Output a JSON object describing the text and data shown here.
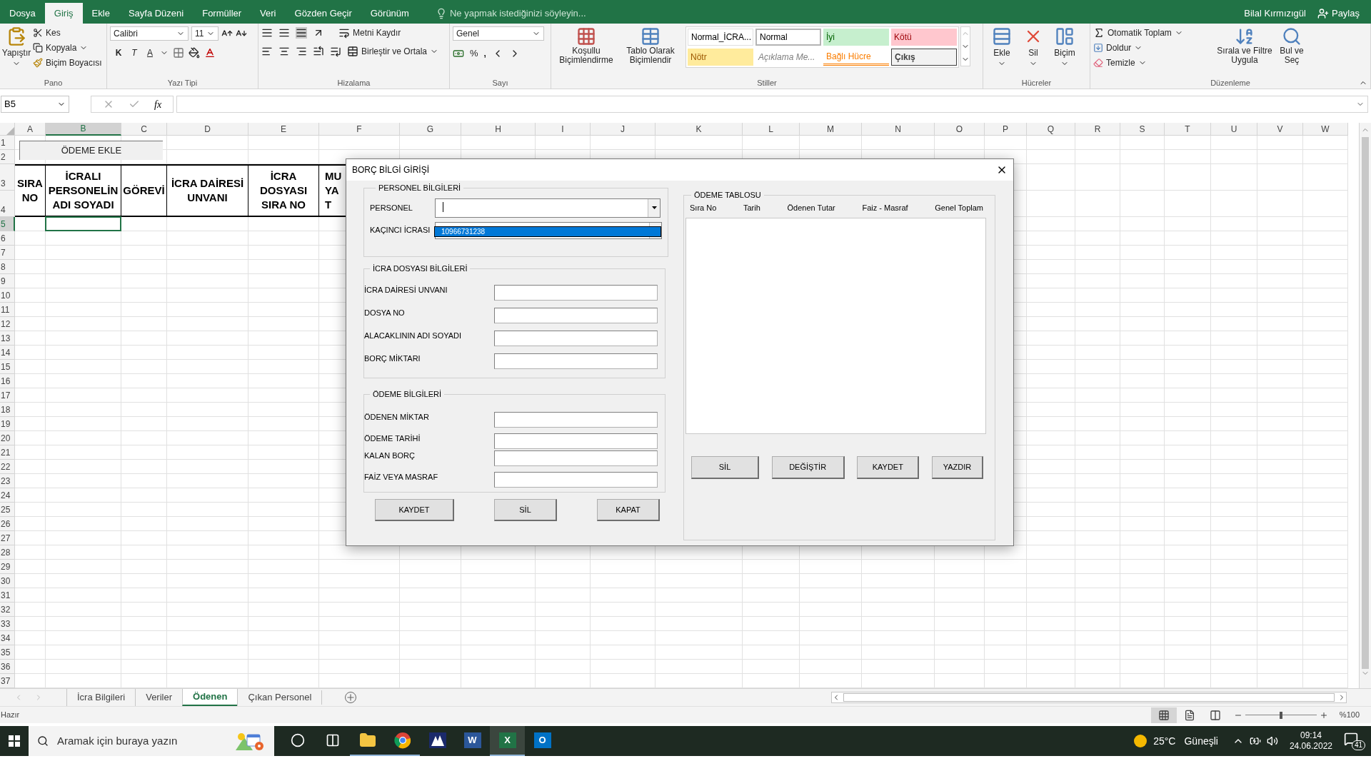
{
  "title_bar": {
    "tabs": [
      {
        "label": "Dosya",
        "selected": false
      },
      {
        "label": "Giriş",
        "selected": true
      },
      {
        "label": "Ekle",
        "selected": false
      },
      {
        "label": "Sayfa Düzeni",
        "selected": false
      },
      {
        "label": "Formüller",
        "selected": false
      },
      {
        "label": "Veri",
        "selected": false
      },
      {
        "label": "Gözden Geçir",
        "selected": false
      },
      {
        "label": "Görünüm",
        "selected": false
      }
    ],
    "tell_me": "Ne yapmak istediğinizi söyleyin...",
    "user": "Bilal Kırmızıgül",
    "share": "Paylaş"
  },
  "ribbon": {
    "clipboard": {
      "paste": "Yapıştır",
      "cut": "Kes",
      "copy": "Kopyala",
      "format_painter": "Biçim Boyacısı",
      "group": "Pano"
    },
    "font": {
      "name": "Calibri",
      "size": "11",
      "bold": "K",
      "italic": "T",
      "underline": "A",
      "group": "Yazı Tipi"
    },
    "alignment": {
      "wrap": "Metni Kaydır",
      "merge": "Birleştir ve Ortala",
      "group": "Hizalama"
    },
    "number": {
      "format": "Genel",
      "percent": "%",
      "comma": ",",
      "group": "Sayı"
    },
    "styles": {
      "conditional": "Koşullu Biçimlendirme",
      "table": "Tablo Olarak Biçimlendir",
      "group": "Stiller",
      "cells": [
        {
          "label": "Normal_İCRA...",
          "kind": "custom"
        },
        {
          "label": "Normal",
          "kind": "normal"
        },
        {
          "label": "İyi",
          "kind": "good"
        },
        {
          "label": "Kötü",
          "kind": "bad"
        },
        {
          "label": "Nötr",
          "kind": "neutral"
        },
        {
          "label": "Açıklama Me...",
          "kind": "note"
        },
        {
          "label": "Bağlı Hücre",
          "kind": "linked"
        },
        {
          "label": "Çıkış",
          "kind": "output"
        }
      ]
    },
    "cells": {
      "insert": "Ekle",
      "delete": "Sil",
      "format": "Biçim",
      "group": "Hücreler"
    },
    "editing": {
      "autosum": "Otomatik Toplam",
      "fill": "Doldur",
      "clear": "Temizle",
      "sort": "Sırala ve Filtre Uygula",
      "find": "Bul ve Seç",
      "group": "Düzenleme"
    }
  },
  "formula_bar": {
    "name_box": "B5",
    "fx": "fx"
  },
  "sheet": {
    "columns": [
      {
        "label": "A",
        "selected": false
      },
      {
        "label": "B",
        "selected": true
      },
      {
        "label": "C",
        "selected": false
      },
      {
        "label": "D",
        "selected": false
      },
      {
        "label": "E",
        "selected": false
      },
      {
        "label": "F",
        "selected": false
      },
      {
        "label": "G",
        "selected": false
      },
      {
        "label": "H",
        "selected": false
      },
      {
        "label": "I",
        "selected": false
      },
      {
        "label": "J",
        "selected": false
      },
      {
        "label": "K",
        "selected": false
      },
      {
        "label": "L",
        "selected": false
      },
      {
        "label": "M",
        "selected": false
      },
      {
        "label": "N",
        "selected": false
      },
      {
        "label": "O",
        "selected": false
      },
      {
        "label": "P",
        "selected": false
      },
      {
        "label": "Q",
        "selected": false
      },
      {
        "label": "R",
        "selected": false
      },
      {
        "label": "S",
        "selected": false
      },
      {
        "label": "T",
        "selected": false
      },
      {
        "label": "U",
        "selected": false
      },
      {
        "label": "V",
        "selected": false
      },
      {
        "label": "W",
        "selected": false
      }
    ],
    "rows": [
      {
        "label": "1",
        "selected": false
      },
      {
        "label": "2",
        "selected": false
      },
      {
        "label": "3",
        "selected": false
      },
      {
        "label": "4",
        "selected": false
      },
      {
        "label": "5",
        "selected": true
      },
      {
        "label": "6",
        "selected": false
      },
      {
        "label": "7",
        "selected": false
      },
      {
        "label": "8",
        "selected": false
      },
      {
        "label": "9",
        "selected": false
      },
      {
        "label": "10",
        "selected": false
      },
      {
        "label": "11",
        "selected": false
      },
      {
        "label": "12",
        "selected": false
      },
      {
        "label": "13",
        "selected": false
      },
      {
        "label": "14",
        "selected": false
      },
      {
        "label": "15",
        "selected": false
      },
      {
        "label": "16",
        "selected": false
      },
      {
        "label": "17",
        "selected": false
      },
      {
        "label": "18",
        "selected": false
      },
      {
        "label": "19",
        "selected": false
      },
      {
        "label": "20",
        "selected": false
      },
      {
        "label": "21",
        "selected": false
      },
      {
        "label": "22",
        "selected": false
      },
      {
        "label": "23",
        "selected": false
      },
      {
        "label": "24",
        "selected": false
      },
      {
        "label": "25",
        "selected": false
      },
      {
        "label": "26",
        "selected": false
      },
      {
        "label": "27",
        "selected": false
      },
      {
        "label": "28",
        "selected": false
      },
      {
        "label": "29",
        "selected": false
      },
      {
        "label": "30",
        "selected": false
      },
      {
        "label": "31",
        "selected": false
      },
      {
        "label": "32",
        "selected": false
      },
      {
        "label": "33",
        "selected": false
      },
      {
        "label": "34",
        "selected": false
      },
      {
        "label": "35",
        "selected": false
      },
      {
        "label": "36",
        "selected": false
      },
      {
        "label": "37",
        "selected": false
      }
    ],
    "add_payment_button": "ÖDEME EKLE",
    "headings": [
      {
        "lines": [
          "SIRA",
          "NO"
        ]
      },
      {
        "lines": [
          "İCRALI",
          "PERSONELİN",
          "ADI SOYADI"
        ]
      },
      {
        "lines": [
          "GÖREVİ"
        ]
      },
      {
        "lines": [
          "İCRA DAİRESİ",
          "UNVANI"
        ]
      },
      {
        "lines": [
          "İCRA",
          "DOSYASI",
          "SIRA NO"
        ]
      },
      {
        "lines": [
          "MU",
          "YA",
          "T"
        ]
      }
    ]
  },
  "dialog": {
    "title": "BORÇ BİLGİ GİRİŞİ",
    "personnel": {
      "legend": "PERSONEL BİLGİLERİ",
      "personnel_label": "PERSONEL",
      "enforcement_label": "KAÇINCI İCRASI",
      "options": [
        {
          "label": "10966731238",
          "selected": true
        }
      ]
    },
    "file": {
      "legend": "İCRA DOSYASI BİLGİLERİ",
      "fields": [
        "İCRA DAİRESİ UNVANI",
        "DOSYA NO",
        "ALACAKLININ ADI SOYADI",
        "BORÇ MİKTARI"
      ]
    },
    "payment": {
      "legend": "ÖDEME BİLGİLERİ",
      "fields": [
        "ÖDENEN MİKTAR",
        "ÖDEME TARİHİ",
        "KALAN BORÇ",
        "FAİZ VEYA MASRAF"
      ]
    },
    "buttons": [
      "KAYDET",
      "SİL",
      "KAPAT"
    ],
    "table": {
      "legend": "ÖDEME TABLOSU",
      "columns": [
        "Sıra No",
        "Tarih",
        "Ödenen Tutar",
        "Faiz - Masraf",
        "Genel Toplam"
      ],
      "buttons": [
        "SİL",
        "DEĞİŞTİR",
        "KAYDET",
        "YAZDIR"
      ]
    }
  },
  "sheet_tabs": [
    {
      "label": "İcra Bilgileri",
      "selected": false
    },
    {
      "label": "Veriler",
      "selected": false
    },
    {
      "label": "Ödenen",
      "selected": true
    },
    {
      "label": "Çıkan Personel",
      "selected": false
    }
  ],
  "status_bar": {
    "status": "Hazır",
    "zoom": "%100",
    "zoom_slider": {
      "level": 0.5
    }
  },
  "taskbar": {
    "search_placeholder": "Aramak için buraya yazın",
    "apps": [
      {
        "kind": "cortana",
        "running": false,
        "active": false
      },
      {
        "kind": "task_view",
        "running": false,
        "active": false
      },
      {
        "kind": "explorer",
        "running": true,
        "active": false
      },
      {
        "kind": "chrome",
        "running": true,
        "active": false
      },
      {
        "kind": "mountain",
        "running": false,
        "active": false
      },
      {
        "kind": "word",
        "glyph": "W",
        "running": false,
        "active": false
      },
      {
        "kind": "excel",
        "glyph": "X",
        "running": true,
        "active": true
      },
      {
        "kind": "outlook",
        "glyph": "O",
        "running": false,
        "active": false
      }
    ],
    "temperature": "25°C",
    "weather": "Güneşli",
    "time": "09:14",
    "date": "24.06.2022",
    "notifications": "41"
  }
}
